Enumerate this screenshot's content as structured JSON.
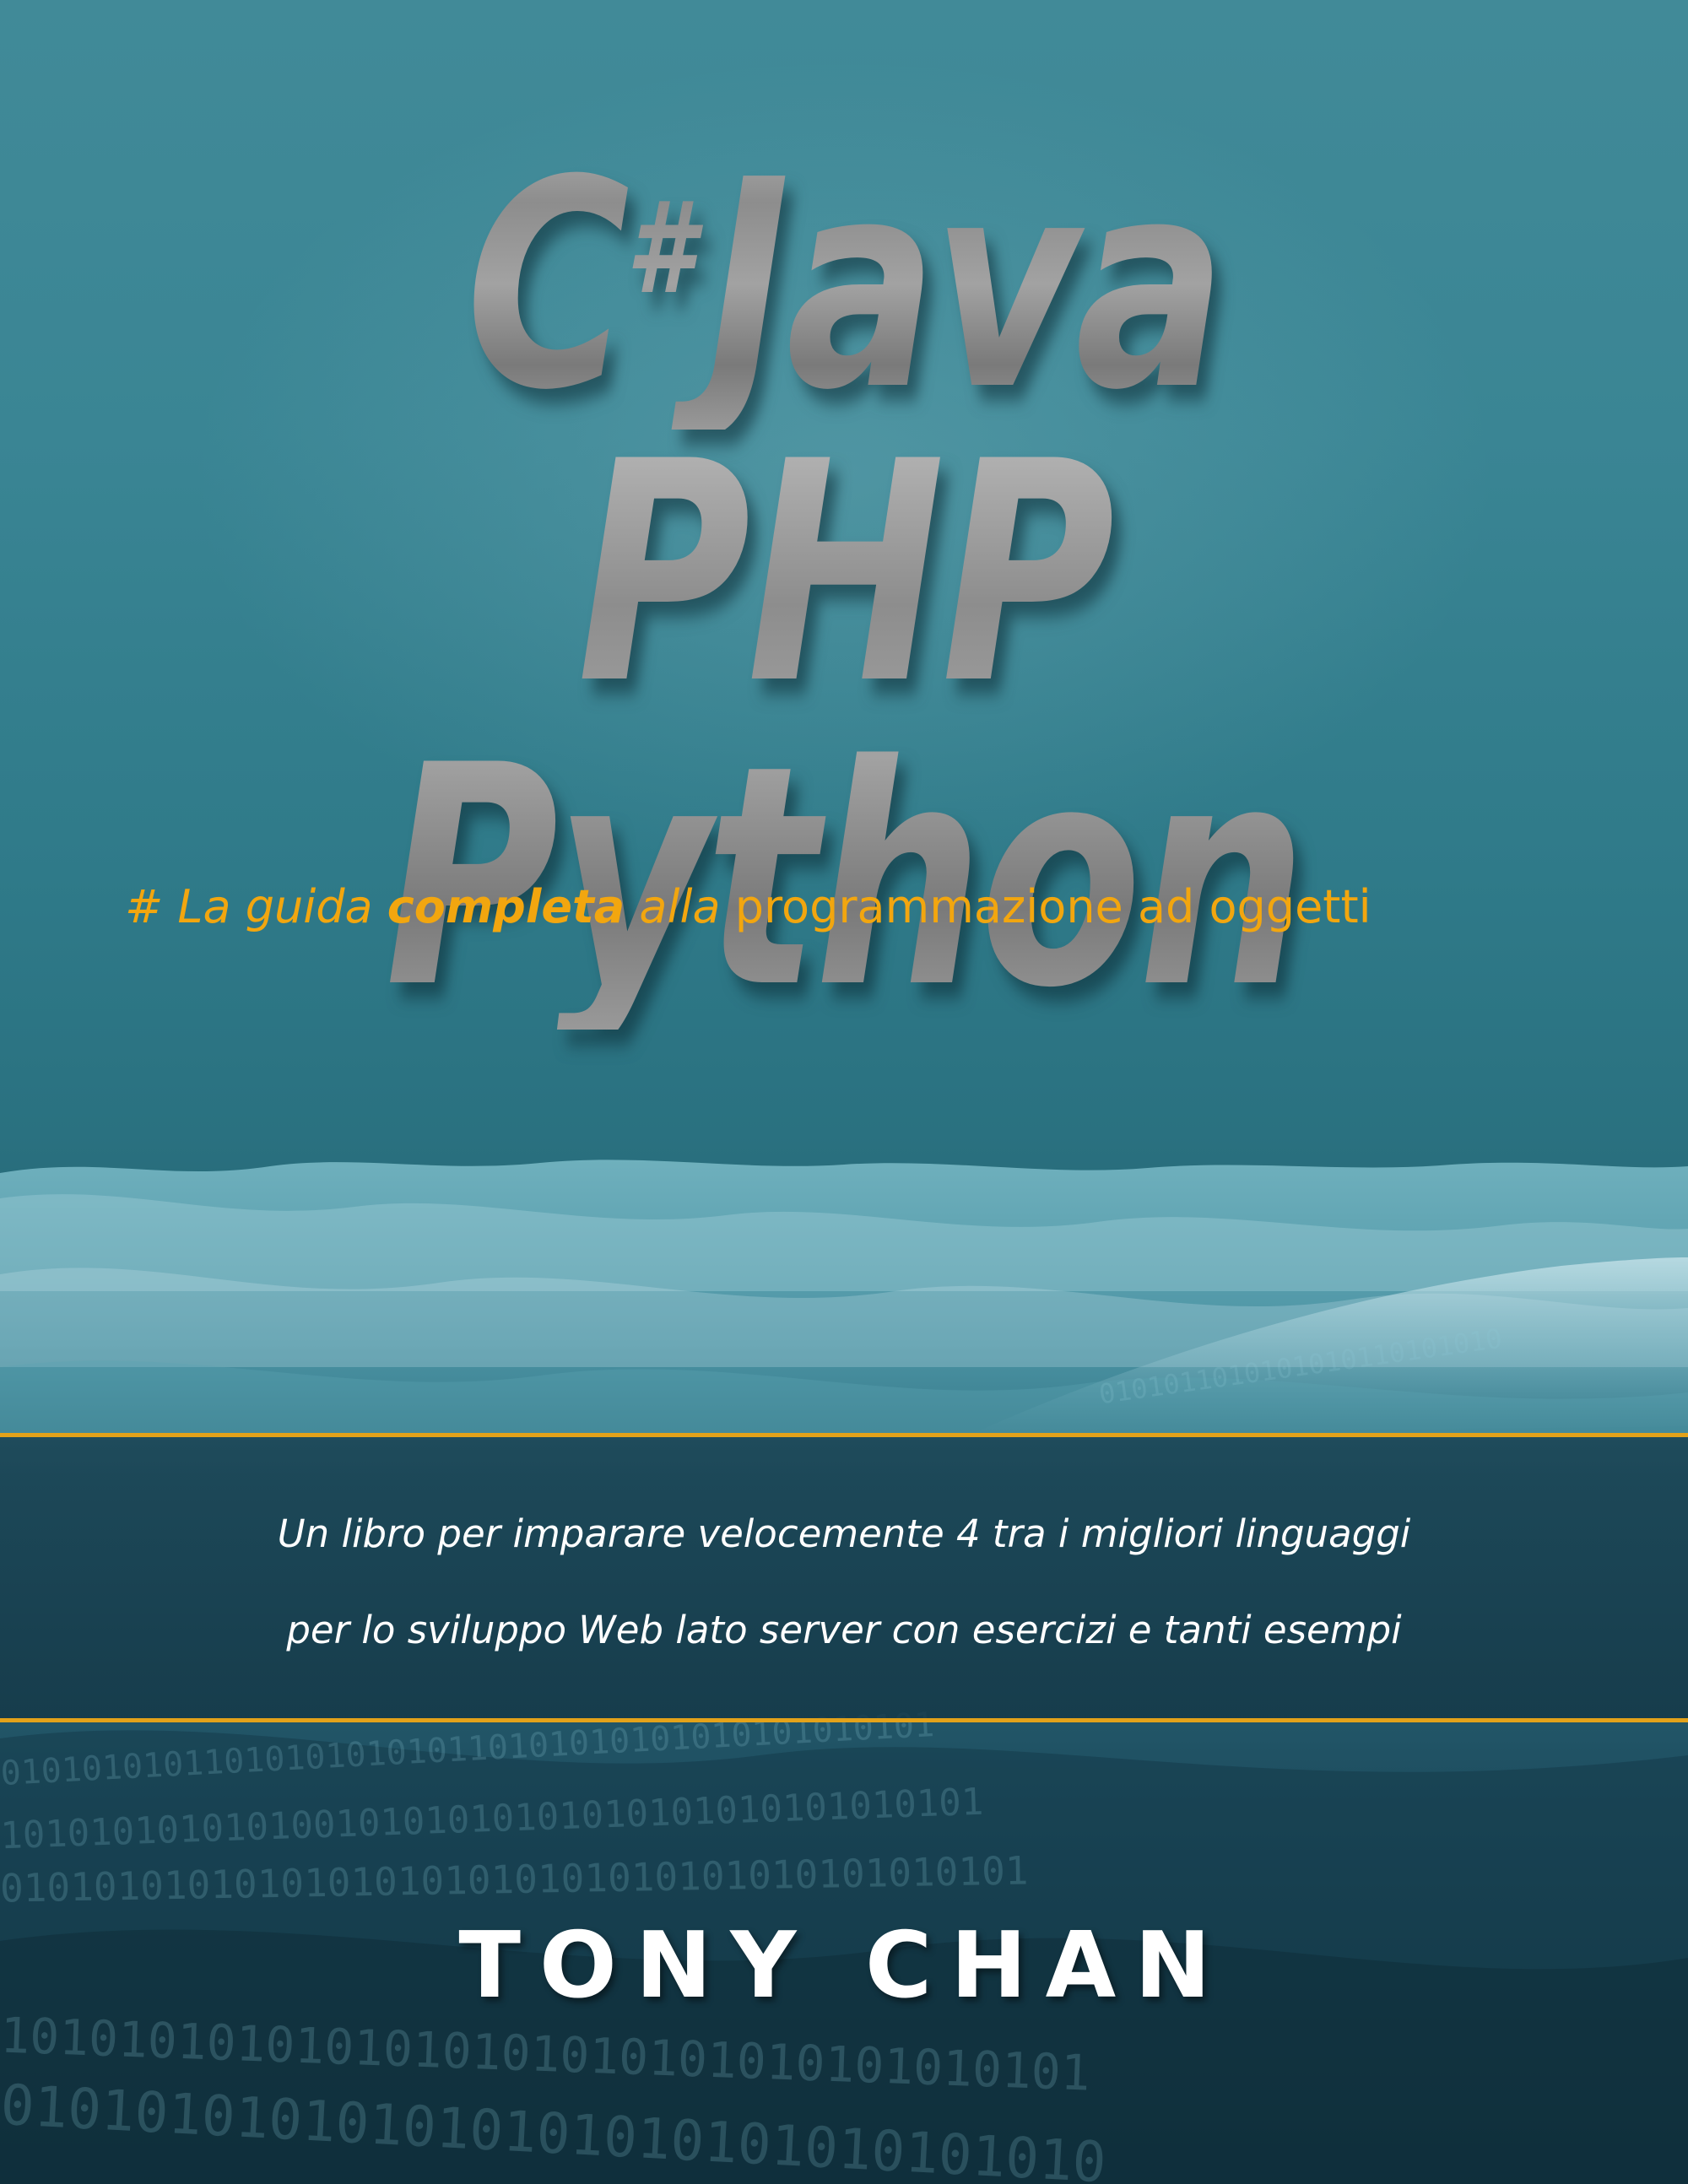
{
  "cover": {
    "title_line_1_a": "C",
    "title_line_1_sharp": "#",
    "title_line_1_b": "Java",
    "title_line_2": "PHP Python",
    "tagline": {
      "part1": "# La guida ",
      "part2": "completa",
      "part3": " alla ",
      "part4": "programmazione ad oggetti"
    },
    "blurb_line_1": "Un libro per imparare velocemente 4 tra i migliori linguaggi",
    "blurb_line_2": "per lo sviluppo Web lato server con esercizi e tanti esempi",
    "author": "TONY CHAN"
  },
  "colors": {
    "accent": "#e3a21a",
    "tagline": "#f2a60f",
    "sky": "#3a8594",
    "sea_dark": "#163d4c"
  }
}
